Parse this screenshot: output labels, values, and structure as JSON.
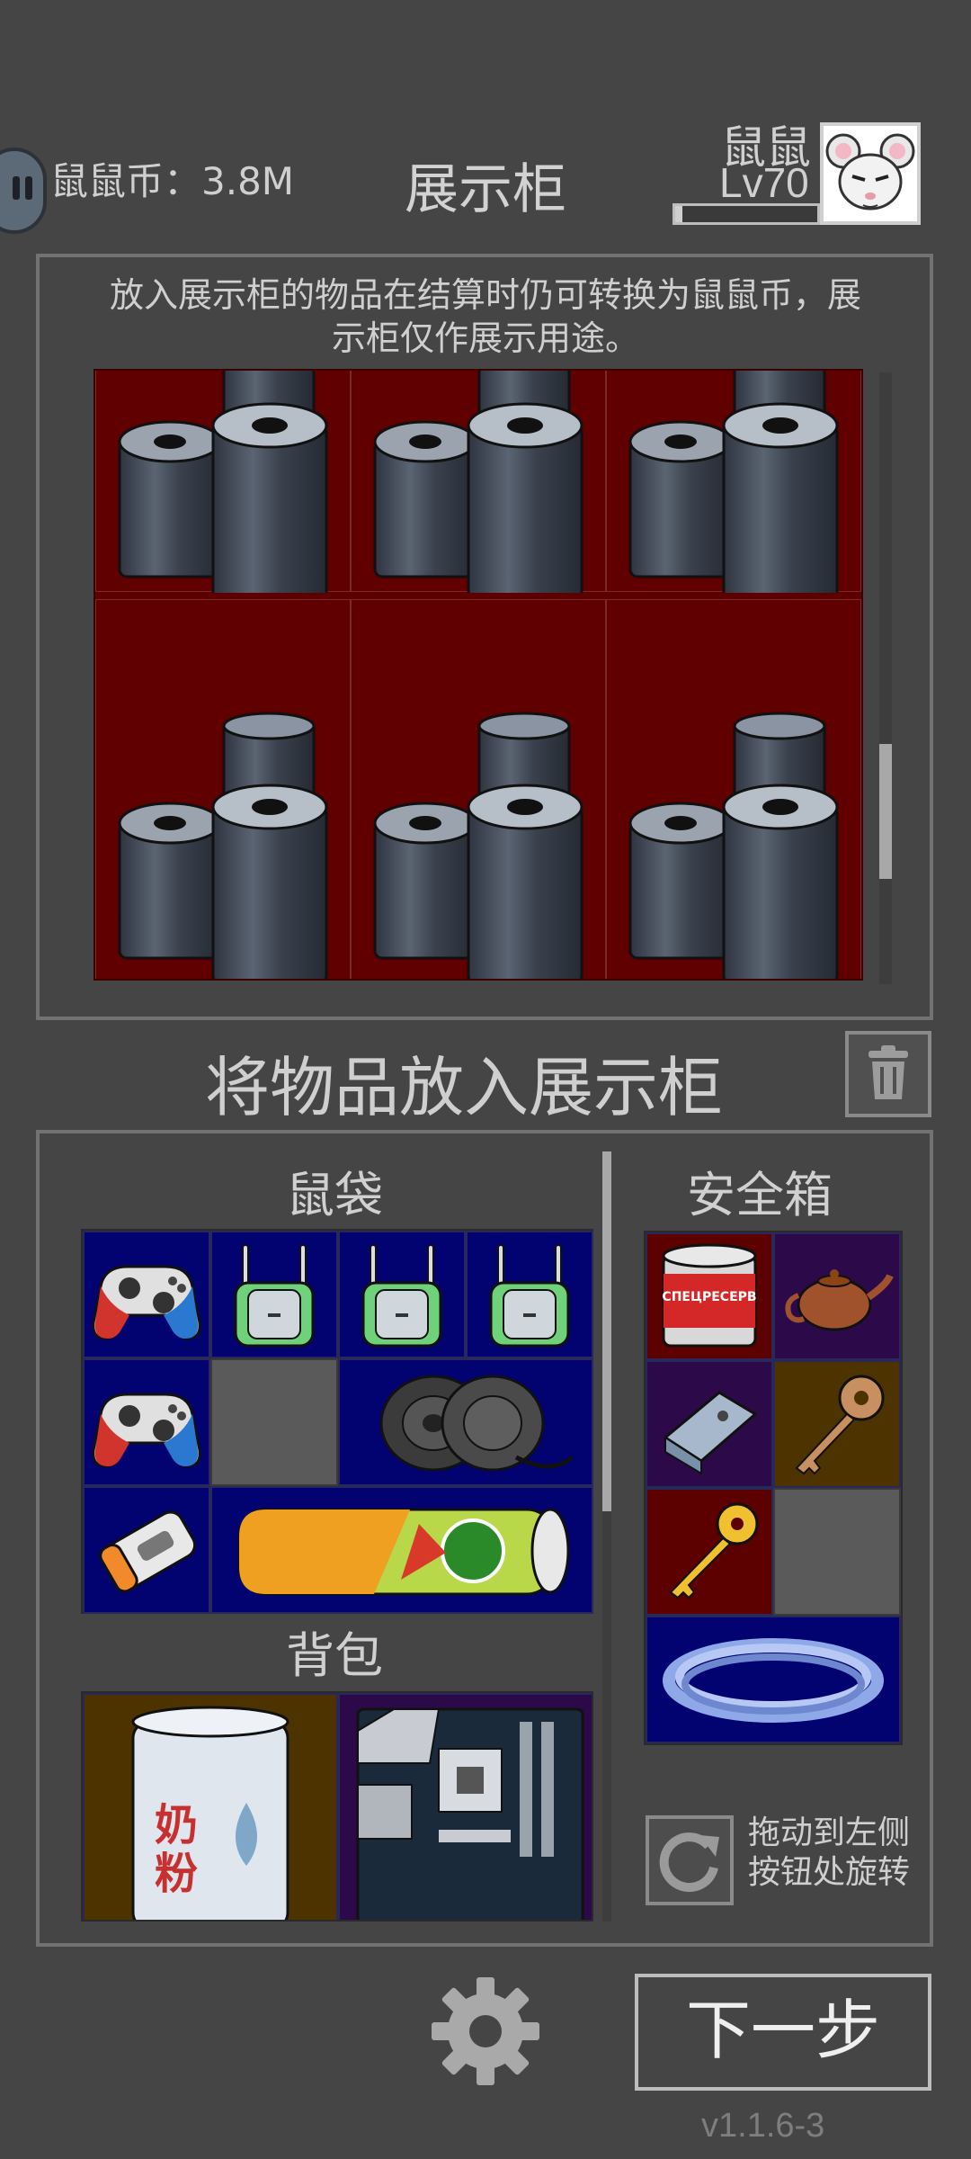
{
  "header": {
    "coin_label": "鼠鼠币：3.8M",
    "title": "展示柜",
    "nickname": "鼠鼠",
    "level": "Lv70",
    "xp_progress": 0.05
  },
  "cabinet": {
    "note": "放入展示柜的物品在结算时仍可转换为鼠鼠币，展示柜仅作展示用途。",
    "items": [
      {
        "name": "tape-rolls-icon",
        "bg": "#5c0000"
      },
      {
        "name": "tape-rolls-icon",
        "bg": "#5c0000"
      },
      {
        "name": "tape-rolls-icon",
        "bg": "#5c0000"
      },
      {
        "name": "tape-rolls-icon",
        "bg": "#5c0000"
      },
      {
        "name": "tape-rolls-icon",
        "bg": "#5c0000"
      },
      {
        "name": "tape-rolls-icon",
        "bg": "#5c0000"
      }
    ],
    "scroll_position": 0.78
  },
  "put_label": "将物品放入展示柜",
  "rat_bag": {
    "title": "鼠袋",
    "items": [
      "gamepad-icon",
      "wifi-router-icon",
      "wifi-router-icon",
      "wifi-router-icon",
      "gamepad-icon",
      "empty-slot",
      "speaker-icon",
      "power-bank-icon",
      "chips-can-icon"
    ]
  },
  "backpack": {
    "title": "背包",
    "items": [
      "milk-powder-icon",
      "motherboard-icon"
    ],
    "milk_label": "奶粉"
  },
  "safe_box": {
    "title": "安全箱",
    "items": [
      "canned-food-icon",
      "teapot-icon",
      "drone-battery-icon",
      "copper-key-icon",
      "gold-key-icon",
      "empty-slot",
      "cable-coil-icon"
    ],
    "can_label": "СПЕЦРЕСЕРВ"
  },
  "rotate_hint": {
    "line1": "拖动到左侧",
    "line2": "按钮处旋转"
  },
  "next_button": "下一步",
  "version": "v1.1.6-3",
  "colors": {
    "background": "#454545",
    "panel_border": "#727272",
    "cabinet_cell": "#5c0000",
    "navy_slot": "#020270"
  }
}
